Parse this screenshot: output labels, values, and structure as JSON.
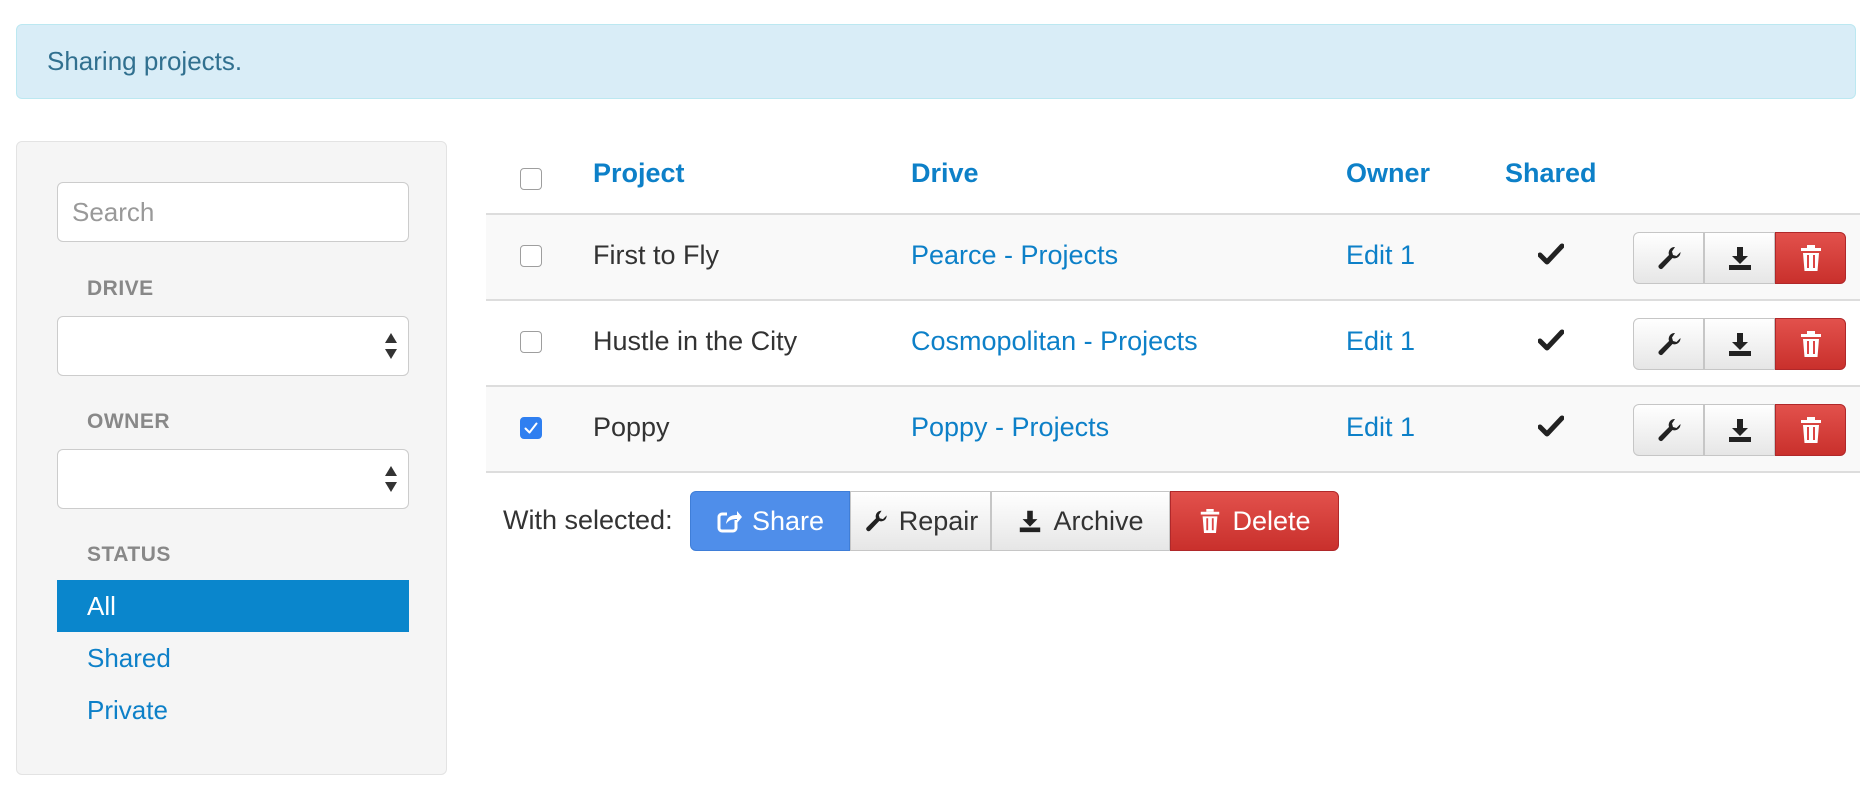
{
  "alert": {
    "text": "Sharing projects."
  },
  "sidebar": {
    "search_placeholder": "Search",
    "drive_label": "DRIVE",
    "drive_value": "",
    "owner_label": "OWNER",
    "owner_value": "",
    "status_label": "STATUS",
    "status_items": [
      {
        "label": "All",
        "active": true
      },
      {
        "label": "Shared",
        "active": false
      },
      {
        "label": "Private",
        "active": false
      }
    ]
  },
  "table": {
    "headers": {
      "project": "Project",
      "drive": "Drive",
      "owner": "Owner",
      "shared": "Shared"
    },
    "select_all_checked": false,
    "rows": [
      {
        "checked": false,
        "project": "First to Fly",
        "drive": "Pearce - Projects",
        "owner": "Edit 1",
        "shared": true
      },
      {
        "checked": false,
        "project": "Hustle in the City",
        "drive": "Cosmopolitan - Projects",
        "owner": "Edit 1",
        "shared": true
      },
      {
        "checked": true,
        "project": "Poppy",
        "drive": "Poppy - Projects",
        "owner": "Edit 1",
        "shared": true
      }
    ],
    "row_actions": [
      "wrench-icon",
      "download-icon",
      "trash-icon"
    ]
  },
  "bulk": {
    "label": "With selected:",
    "share": "Share",
    "repair": "Repair",
    "archive": "Archive",
    "delete": "Delete"
  },
  "colors": {
    "accent": "#0d80c8",
    "active_bg": "#0a86cc",
    "alert_bg": "#d9edf7",
    "alert_text": "#31708f",
    "danger": "#d9534f",
    "primary": "#4f8eea",
    "checkbox_checked": "#2f7ff0"
  }
}
